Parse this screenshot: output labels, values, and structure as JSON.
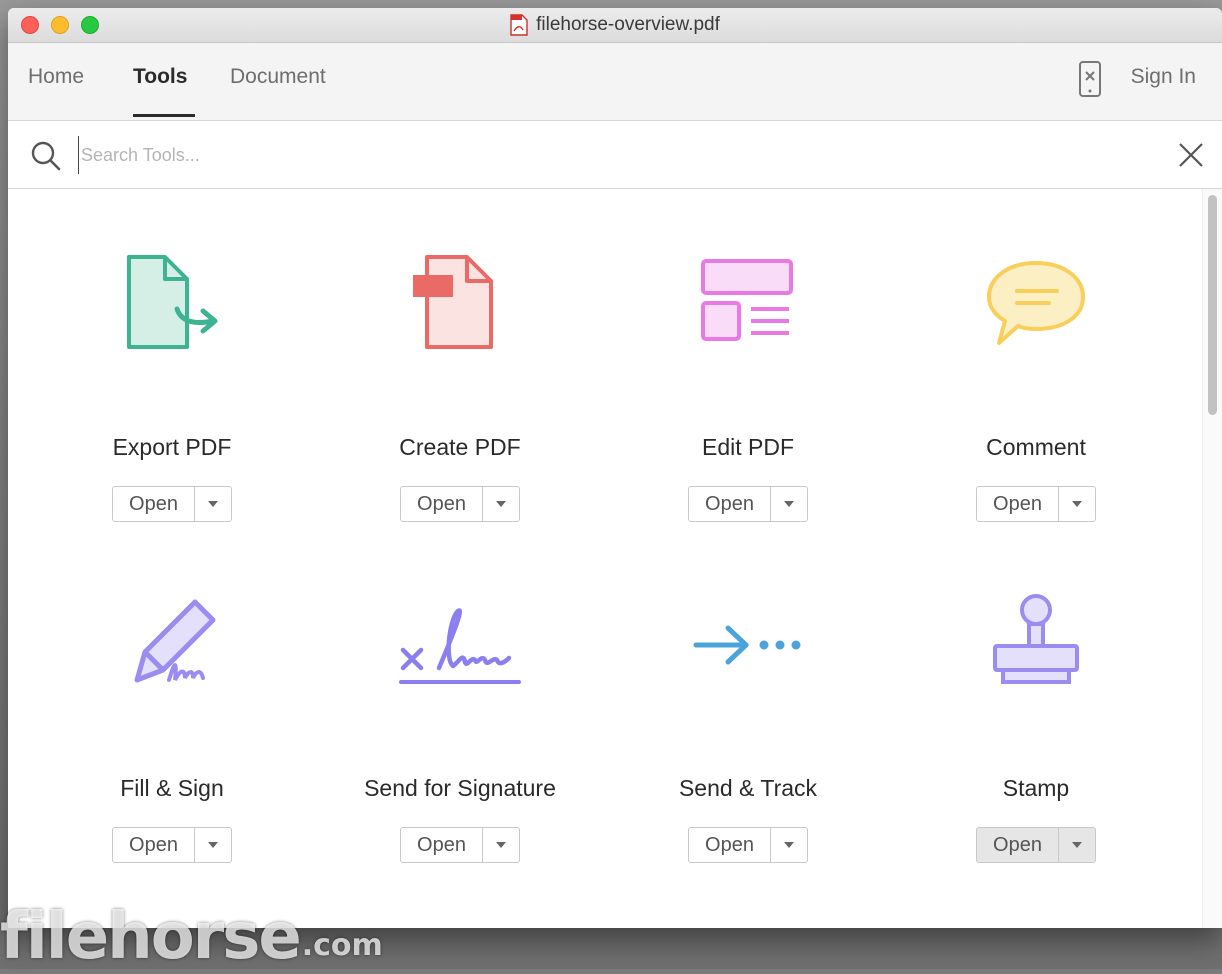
{
  "window": {
    "title": "filehorse-overview.pdf"
  },
  "nav": {
    "tabs": [
      {
        "label": "Home",
        "active": false
      },
      {
        "label": "Tools",
        "active": true
      },
      {
        "label": "Document",
        "active": false
      }
    ],
    "signin_label": "Sign In"
  },
  "search": {
    "placeholder": "Search Tools...",
    "value": ""
  },
  "tools": [
    {
      "name": "Export PDF",
      "button": "Open",
      "icon": "export-pdf-icon",
      "color": "#3db391"
    },
    {
      "name": "Create PDF",
      "button": "Open",
      "icon": "create-pdf-icon",
      "color": "#ea6b66"
    },
    {
      "name": "Edit PDF",
      "button": "Open",
      "icon": "edit-pdf-icon",
      "color": "#e879e5"
    },
    {
      "name": "Comment",
      "button": "Open",
      "icon": "comment-icon",
      "color": "#f9cf5c"
    },
    {
      "name": "Fill & Sign",
      "button": "Open",
      "icon": "fill-sign-icon",
      "color": "#9b8cf2"
    },
    {
      "name": "Send for Signature",
      "button": "Open",
      "icon": "send-for-signature-icon",
      "color": "#8b7ff0"
    },
    {
      "name": "Send & Track",
      "button": "Open",
      "icon": "send-track-icon",
      "color": "#4aa3da"
    },
    {
      "name": "Stamp",
      "button": "Open",
      "icon": "stamp-icon",
      "color": "#9b8cf2"
    }
  ],
  "watermark": {
    "main": "filehorse",
    "suffix": ".com"
  }
}
